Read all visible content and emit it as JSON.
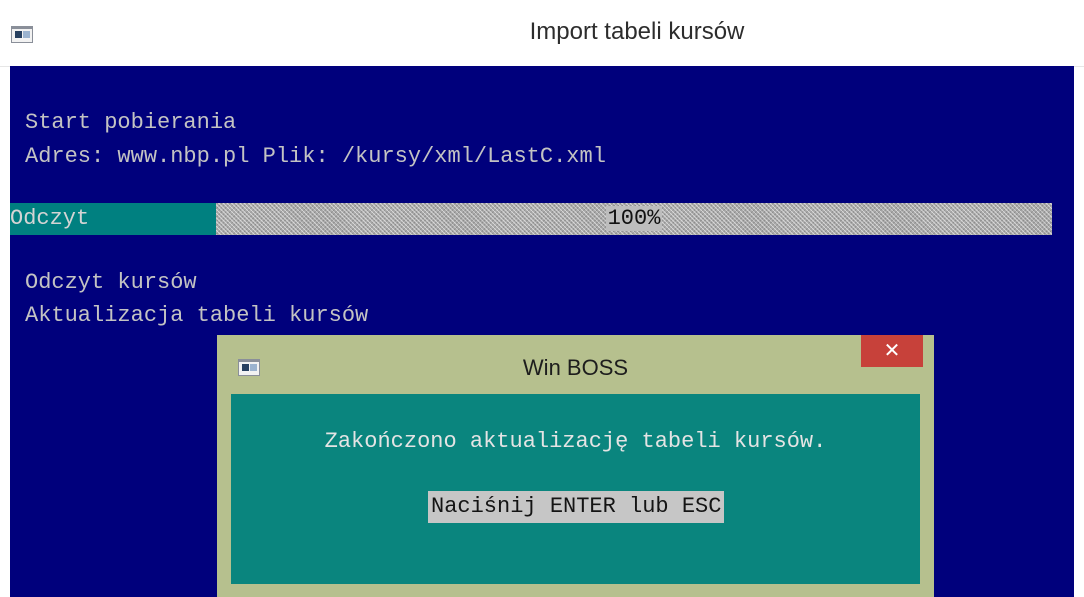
{
  "window": {
    "title": "Import tabeli kursów",
    "icon": "console-app-icon"
  },
  "console": {
    "lines": [
      "Start pobierania",
      "Adres: www.nbp.pl Plik: /kursy/xml/LastC.xml"
    ],
    "progress": {
      "label": "Odczyt",
      "percent_text": "100%",
      "value": 100
    },
    "lines_after": [
      "Odczyt kursów",
      "Aktualizacja tabeli kursów"
    ]
  },
  "dialog": {
    "title": "Win BOSS",
    "close_label": "✕",
    "message": "Zakończono aktualizację tabeli kursów.",
    "button_label": "Naciśnij ENTER lub ESC"
  },
  "colors": {
    "console_bg": "#00007c",
    "dialog_frame": "#b6c08e",
    "dialog_body": "#0a857e",
    "close_red": "#c7413a"
  }
}
